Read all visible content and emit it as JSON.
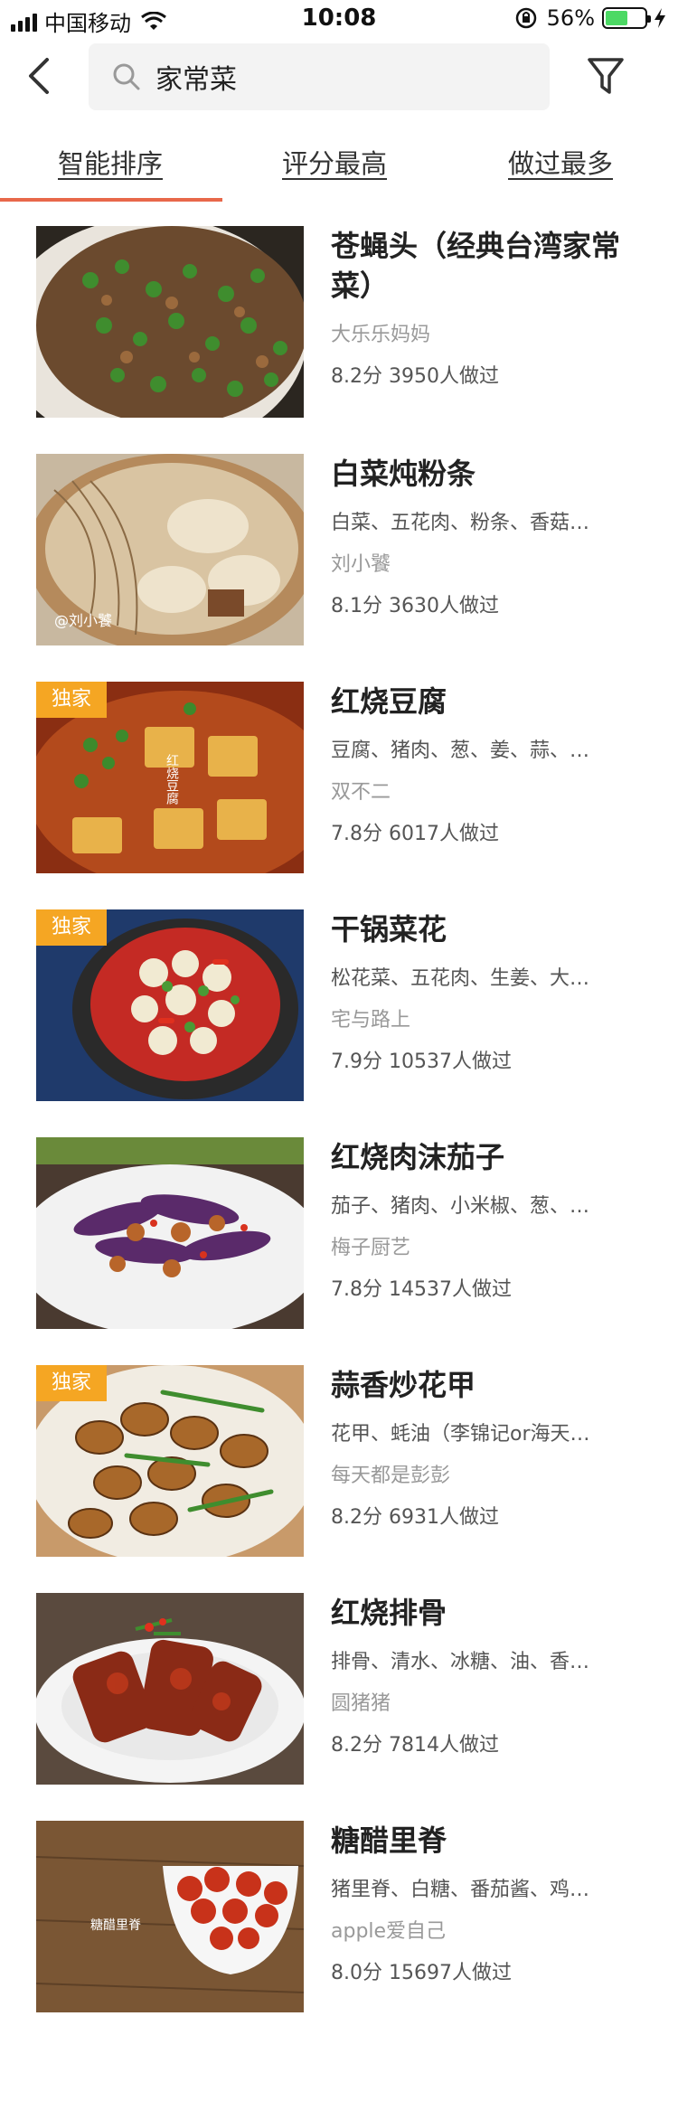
{
  "status_bar": {
    "carrier": "中国移动",
    "time": "10:08",
    "battery": "56%",
    "battery_level": 0.56
  },
  "search": {
    "query": "家常菜"
  },
  "tabs": [
    {
      "label": "智能排序",
      "active": true
    },
    {
      "label": "评分最高",
      "active": false
    },
    {
      "label": "做过最多",
      "active": false
    }
  ],
  "colors": {
    "accent": "#e8684a",
    "badge": "#f5a623"
  },
  "recipes": [
    {
      "title": "苍蝇头（经典台湾家常菜）",
      "ingredients": "",
      "author": "大乐乐妈妈",
      "stats": "8.2分 3950人做过",
      "badge": "",
      "image_watermark": ""
    },
    {
      "title": "白菜炖粉条",
      "ingredients": "白菜、五花肉、粉条、香菇…",
      "author": "刘小饕",
      "stats": "8.1分 3630人做过",
      "badge": "",
      "image_watermark": "@刘小饕"
    },
    {
      "title": "红烧豆腐",
      "ingredients": "豆腐、猪肉、葱、姜、蒜、…",
      "author": "双不二",
      "stats": "7.8分 6017人做过",
      "badge": "独家",
      "image_watermark": "红烧豆腐"
    },
    {
      "title": "干锅菜花",
      "ingredients": "松花菜、五花肉、生姜、大…",
      "author": "宅与路上",
      "stats": "7.9分 10537人做过",
      "badge": "独家",
      "image_watermark": ""
    },
    {
      "title": "红烧肉沫茄子",
      "ingredients": "茄子、猪肉、小米椒、葱、…",
      "author": "梅子厨艺",
      "stats": "7.8分 14537人做过",
      "badge": "",
      "image_watermark": ""
    },
    {
      "title": "蒜香炒花甲",
      "ingredients": "花甲、蚝油（李锦记or海天…",
      "author": "每天都是彭彭",
      "stats": "8.2分 6931人做过",
      "badge": "独家",
      "image_watermark": ""
    },
    {
      "title": "红烧排骨",
      "ingredients": "排骨、清水、冰糖、油、香…",
      "author": "圆猪猪",
      "stats": "8.2分 7814人做过",
      "badge": "",
      "image_watermark": ""
    },
    {
      "title": "糖醋里脊",
      "ingredients": "猪里脊、白糖、番茄酱、鸡…",
      "author": "apple爱自己",
      "stats": "8.0分 15697人做过",
      "badge": "",
      "image_watermark": "糖醋里脊"
    }
  ]
}
